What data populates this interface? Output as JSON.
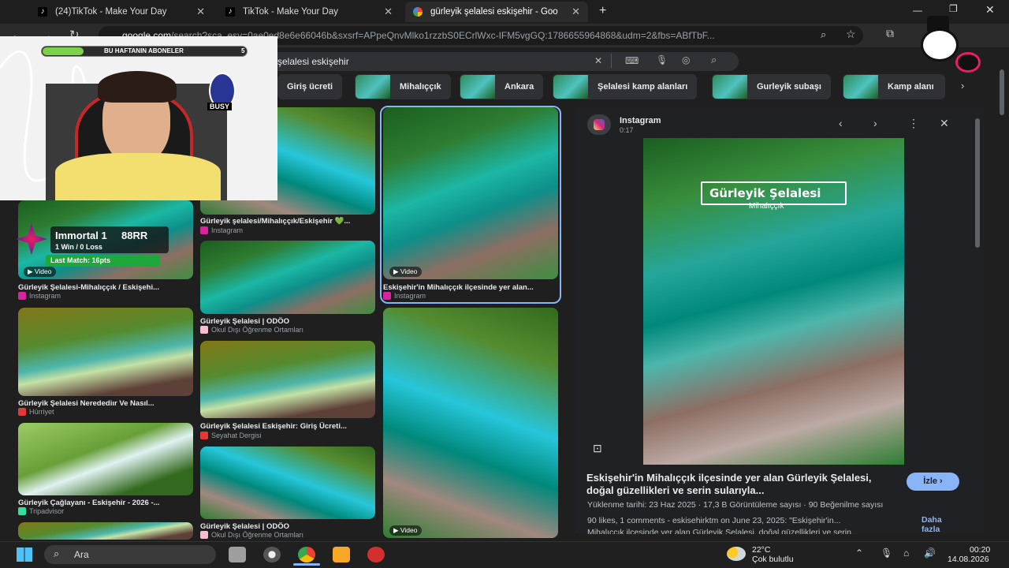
{
  "browser": {
    "tabs": [
      {
        "title": "(24)TikTok - Make Your Day"
      },
      {
        "title": "TikTok - Make Your Day"
      },
      {
        "title": "gürleyik şelalesi eskişehir - Goo"
      }
    ],
    "url_domain": "google.com",
    "url_rest": "/search?sca_esy=0ae0ed8e6e66046b&sxsrf=APpeQnvMlko1rzzbS0ECrlWxc-IFM5vgGQ:1786655964868&udm=2&fbs=ABfTbF..."
  },
  "search": {
    "query": "şelalesi eskişehir"
  },
  "chips": [
    {
      "label": "Giriş ücreti"
    },
    {
      "label": "Mihalıççık"
    },
    {
      "label": "Ankara"
    },
    {
      "label": "Şelalesi kamp alanları"
    },
    {
      "label": "Gurleyik subaşı"
    },
    {
      "label": "Kamp alanı"
    }
  ],
  "overlay": {
    "subscribers_label": "BU HAFTANIN ABONELER",
    "subscribers_count": "5",
    "rank": "Immortal 1",
    "rr": "88RR",
    "record": "1 Win / 0 Loss",
    "last_match": "Last Match: 16pts",
    "logo_text": "BUSY"
  },
  "results": {
    "col1": [
      {
        "caption": "Gürleyik Şelalesi-Mihalıççık / Eskişehi...",
        "source": "Instagram",
        "badge": "Video"
      },
      {
        "caption": "Gürleyik Şelalesi Neredediır Ve Nasıl...",
        "source": "Hürriyet"
      },
      {
        "caption": "Gürleyik Çağlayanı - Eskişehir - 2026 -...",
        "source": "Tripadvisor"
      }
    ],
    "col2": [
      {
        "caption": "Gürleyik şelalesi/Mihalıççık/Eskişehir 💚...",
        "source": "Instagram"
      },
      {
        "caption": "Gürleyik Şelalesi | ODÖO",
        "source": "Okul Dışı Öğrenme Ortamları"
      },
      {
        "caption": "Gürleyik Şelalesi Eskişehir: Giriş Ücreti...",
        "source": "Seyahat Dergisi"
      },
      {
        "caption": "Gürleyik Şelalesi | ODÖO",
        "source": "Okul Dışı Öğrenme Ortamları"
      }
    ],
    "col3": [
      {
        "caption": "Eskişehir'in Mihalıççık ilçesinde yer alan...",
        "source": "Instagram",
        "badge": "Video"
      },
      {
        "badge": "Video"
      }
    ]
  },
  "preview": {
    "source": "Instagram",
    "duration": "0:17",
    "overlay_title": "Gürleyik Şelalesi",
    "overlay_subtitle": "Mihalıççık",
    "title": "Eskişehir'in Mihalıççık ilçesinde yer alan Gürleyik Şelalesi, doğal güzellikleri ve serin sularıyla...",
    "watch_label": "İzle",
    "meta": "Yüklenme tarihi: 23 Haz 2025  ·  17,3 B Görüntüleme sayısı  ·  90 Beğenilme sayısı",
    "desc_line1": "90 likes, 1 comments - eskisehirktm on June 23, 2025: \"Eskişehir'in...",
    "desc_line2": "Mihalıççık ilçesinde yer alan Gürleyik Şelalesi, doğal güzellikleri ve serin...",
    "more_label": "Daha fazla"
  },
  "taskbar": {
    "search_placeholder": "Ara",
    "weather_temp": "22°C",
    "weather_desc": "Çok bulutlu",
    "time": "00:20",
    "date": "14.08.2026"
  },
  "colors": {
    "accent": "#8ab4f8",
    "instagram": "#d6249f",
    "bg": "#1f1f1f"
  }
}
